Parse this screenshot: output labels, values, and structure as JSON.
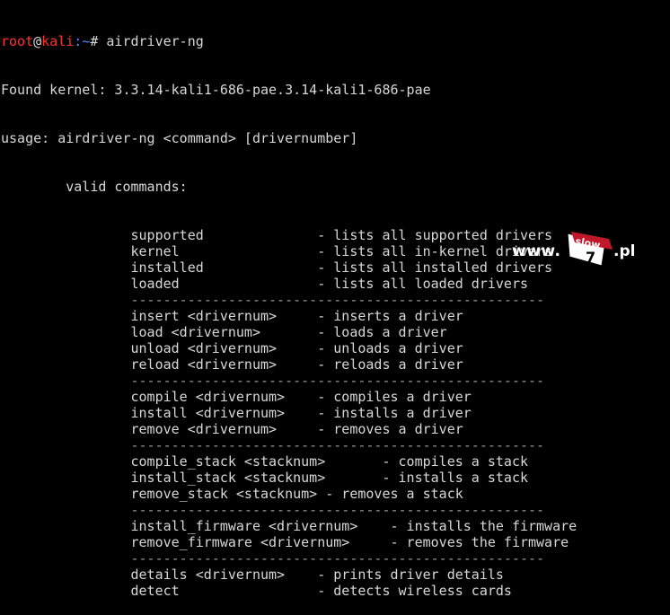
{
  "prompt": {
    "user": "root",
    "at": "@",
    "host": "kali",
    "path": ":~",
    "symbol": "#",
    "command": " airdriver-ng"
  },
  "output": {
    "found_kernel": "Found kernel: 3.3.14-kali1-686-pae.3.14-kali1-686-pae",
    "usage": "usage: airdriver-ng <command> [drivernumber]",
    "valid_commands": "        valid commands:"
  },
  "commands": [
    {
      "text": "                supported              - lists all supported drivers"
    },
    {
      "text": "                kernel                 - lists all in-kernel drivers"
    },
    {
      "text": "                installed              - lists all installed drivers"
    },
    {
      "text": "                loaded                 - lists all loaded drivers"
    },
    {
      "text": "                ---------------------------------------------------",
      "separator": true
    },
    {
      "text": "                insert <drivernum>     - inserts a driver"
    },
    {
      "text": "                load <drivernum>       - loads a driver"
    },
    {
      "text": "                unload <drivernum>     - unloads a driver"
    },
    {
      "text": "                reload <drivernum>     - reloads a driver"
    },
    {
      "text": "                ---------------------------------------------------",
      "separator": true
    },
    {
      "text": "                compile <drivernum>    - compiles a driver"
    },
    {
      "text": "                install <drivernum>    - installs a driver"
    },
    {
      "text": "                remove <drivernum>     - removes a driver"
    },
    {
      "text": "                ---------------------------------------------------",
      "separator": true
    },
    {
      "text": "                compile_stack <stacknum>       - compiles a stack"
    },
    {
      "text": "                install_stack <stacknum>       - installs a stack"
    },
    {
      "text": "                remove_stack <stacknum> - removes a stack"
    },
    {
      "text": "                ---------------------------------------------------",
      "separator": true
    },
    {
      "text": "                install_firmware <drivernum>    - installs the firmware"
    },
    {
      "text": "                remove_firmware <drivernum>     - removes the firmware"
    },
    {
      "text": "                ---------------------------------------------------",
      "separator": true
    },
    {
      "text": "                details <drivernum>    - prints driver details"
    },
    {
      "text": "                detect                 - detects wireless cards"
    }
  ],
  "watermark": {
    "prefix": "www.",
    "logo_top": "slow",
    "logo_bottom": "7",
    "suffix": ".pl"
  },
  "colors": {
    "background": "#000000",
    "text": "#d8d8d8",
    "prompt_red": "#ff3030",
    "prompt_blue": "#5b8cff"
  }
}
